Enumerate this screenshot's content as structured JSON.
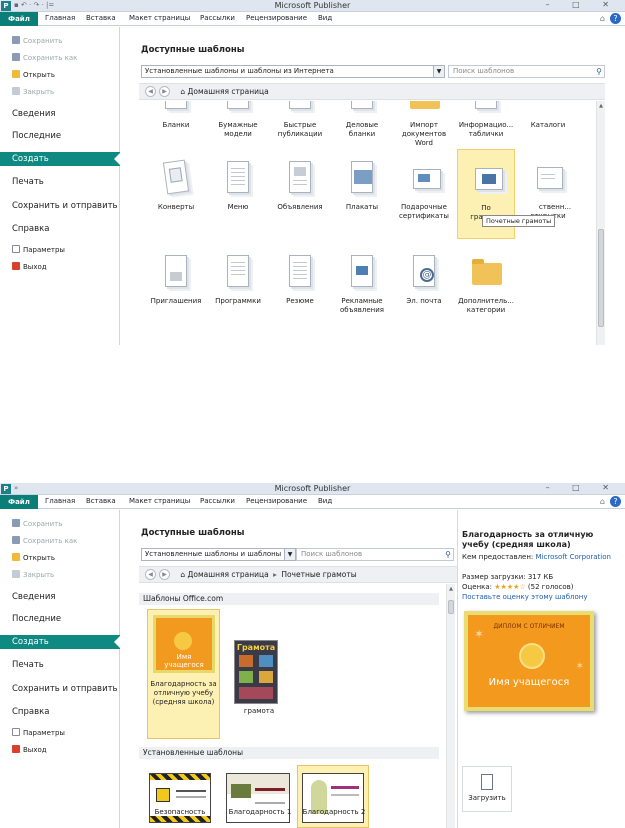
{
  "app": {
    "title": "Microsoft Publisher",
    "logo": "P",
    "quick_access": "▪ ↶ · ↷ · |=",
    "quick_access_2": "»",
    "win_buttons": "– □ ✕",
    "minimize_ribbon": "⌂",
    "help": "?"
  },
  "ribbon": {
    "file": "Файл",
    "tabs": [
      "Главная",
      "Вставка",
      "Макет страницы",
      "Рассылки",
      "Рецензирование",
      "Вид"
    ]
  },
  "sidebar": {
    "save": "Сохранить",
    "save_as": "Сохранить как",
    "open": "Открыть",
    "close": "Закрыть",
    "info": "Сведения",
    "recent": "Последние",
    "create": "Создать",
    "print": "Печать",
    "save_send": "Сохранить и отправить",
    "help": "Справка",
    "options": "Параметры",
    "exit": "Выход"
  },
  "screen1": {
    "heading": "Доступные шаблоны",
    "source_select": "Установленные шаблоны и шаблоны из Интернета",
    "search_placeholder": "Поиск шаблонов",
    "nav_home": "Домашняя страница",
    "row1": [
      "Бланки",
      "Бумажные модели",
      "Быстрые публикации",
      "Деловые бланки",
      "Импорт документов Word",
      "Информацио... таблички",
      "Каталоги"
    ],
    "row2": [
      "Конверты",
      "Меню",
      "Объявления",
      "Плакаты",
      "Подарочные сертификаты",
      "Почетные грамоты",
      "Поздравительн... открытки"
    ],
    "row2_selected_label_part": "По",
    "row2_selected_label_part2": "грамоты",
    "row2_last_part": "ственн...",
    "row2_last_part2": "открытки",
    "row3": [
      "Приглашения",
      "Программки",
      "Резюме",
      "Рекламные объявления",
      "Эл. почта",
      "Дополнитель... категории"
    ],
    "tooltip": "Почетные грамоты"
  },
  "screen2": {
    "heading": "Доступные шаблоны",
    "source_select": "Установленные шаблоны и шаблоны из I",
    "search_placeholder": "Поиск шаблонов",
    "nav_home": "Домашняя страница",
    "nav_sep": "▸",
    "nav_current": "Почетные грамоты",
    "office_section": "Шаблоны Office.com",
    "office_items": [
      "Благодарность за отличную учебу (средняя школа)",
      "грамота"
    ],
    "installed_section": "Установленные шаблоны",
    "installed_items": [
      "Безопасность",
      "Благодарность 1",
      "Благодарность 2"
    ],
    "preview_cert_title": "ДИПЛОМ С ОТЛИЧИЕМ",
    "preview_cert_name": "Имя учащегося",
    "thumb_cert_name": "Имя учащегося",
    "gramota_title": "Грамота",
    "right": {
      "title": "Благодарность за отличную учебу (средняя школа)",
      "provider_label": "Кем предоставлен:",
      "provider": "Microsoft Corporation",
      "size": "Размер загрузки: 317 КБ",
      "rating_label": "Оценка:",
      "rating_stars": "★★★★☆",
      "rating_votes": "(52 голосов)",
      "rate_link": "Поставьте оценку этому шаблону",
      "download": "Загрузить"
    }
  },
  "colors": {
    "accent": "#0f8a82",
    "selected_bg": "#fdf0b3",
    "link": "#1f5fb5",
    "cert_orange": "#f39a1e"
  }
}
